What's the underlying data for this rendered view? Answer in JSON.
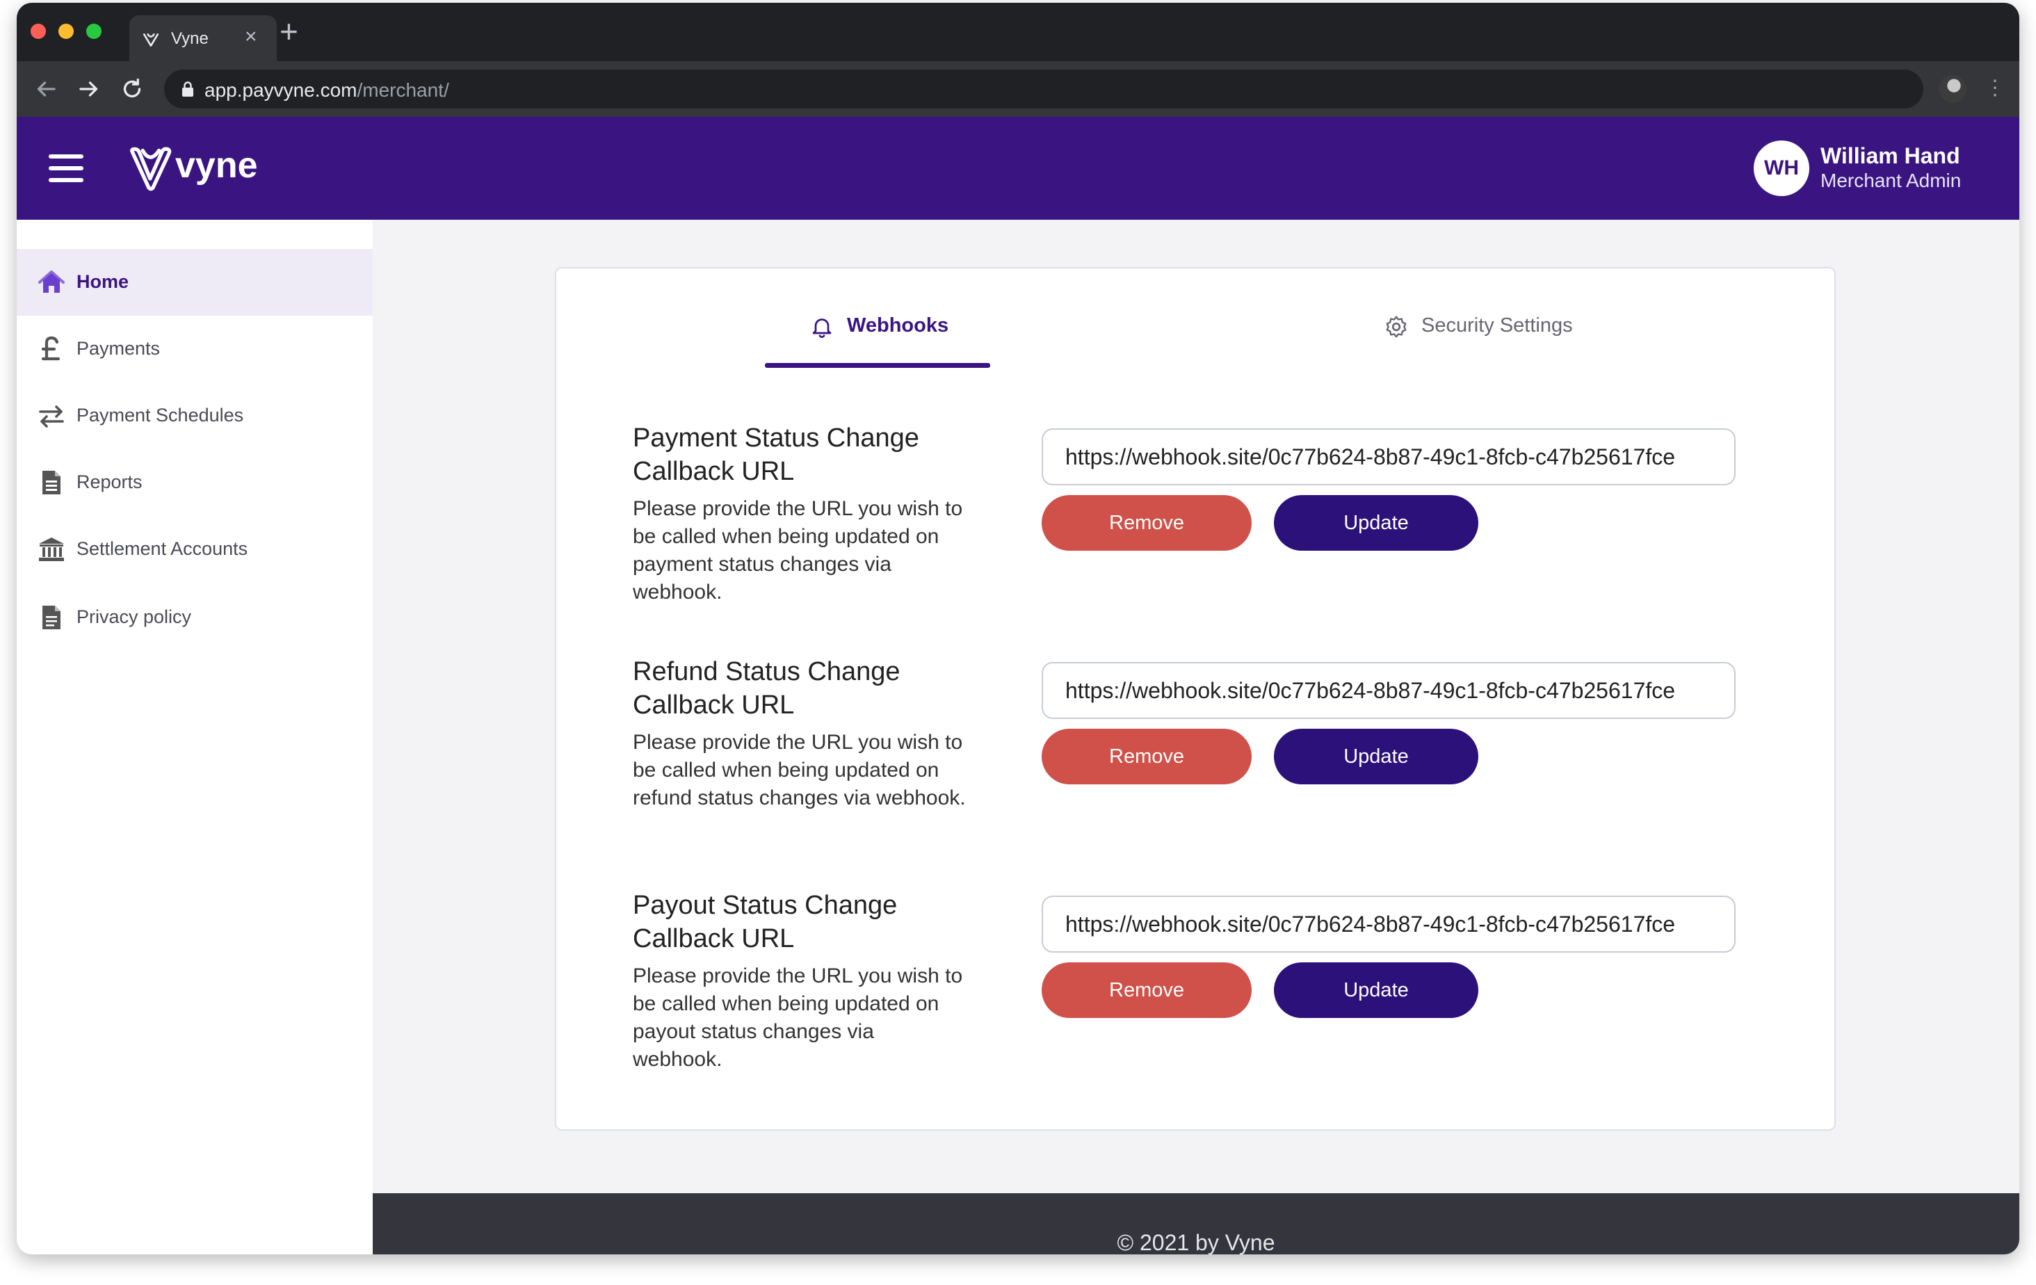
{
  "browser": {
    "tab_title": "Vyne",
    "url_host": "app.payvyne.com",
    "url_path": "/merchant/"
  },
  "header": {
    "logo_text": "vyne",
    "user_initials": "WH",
    "user_name": "William Hand",
    "user_role": "Merchant Admin"
  },
  "sidebar": {
    "items": [
      {
        "label": "Home",
        "icon": "home-icon",
        "active": true
      },
      {
        "label": "Payments",
        "icon": "pound-icon",
        "active": false
      },
      {
        "label": "Payment Schedules",
        "icon": "arrows-exchange-icon",
        "active": false
      },
      {
        "label": "Reports",
        "icon": "report-document-icon",
        "active": false
      },
      {
        "label": "Settlement Accounts",
        "icon": "bank-icon",
        "active": false
      },
      {
        "label": "Privacy policy",
        "icon": "document-icon",
        "active": false
      }
    ]
  },
  "tabs": [
    {
      "label": "Webhooks",
      "icon": "bell-icon",
      "active": true
    },
    {
      "label": "Security Settings",
      "icon": "gear-icon",
      "active": false
    }
  ],
  "sections": [
    {
      "title": "Payment Status Change Callback URL",
      "description": "Please provide the URL you wish to be called when being updated on payment status changes via webhook.",
      "url_value": "https://webhook.site/0c77b624-8b87-49c1-8fcb-c47b25617fce",
      "remove_label": "Remove",
      "update_label": "Update"
    },
    {
      "title": "Refund Status Change Callback URL",
      "description": "Please provide the URL you wish to be called when being updated on refund status changes via webhook.",
      "url_value": "https://webhook.site/0c77b624-8b87-49c1-8fcb-c47b25617fce",
      "remove_label": "Remove",
      "update_label": "Update"
    },
    {
      "title": "Payout Status Change Callback URL",
      "description": "Please provide the URL you wish to be called when being updated on payout status changes via webhook.",
      "url_value": "https://webhook.site/0c77b624-8b87-49c1-8fcb-c47b25617fce",
      "remove_label": "Remove",
      "update_label": "Update"
    }
  ],
  "footer": {
    "text": "© 2021 by Vyne"
  },
  "colors": {
    "brand": "#3a1582",
    "update_button": "#2c117a",
    "remove_button": "#cf5149"
  }
}
